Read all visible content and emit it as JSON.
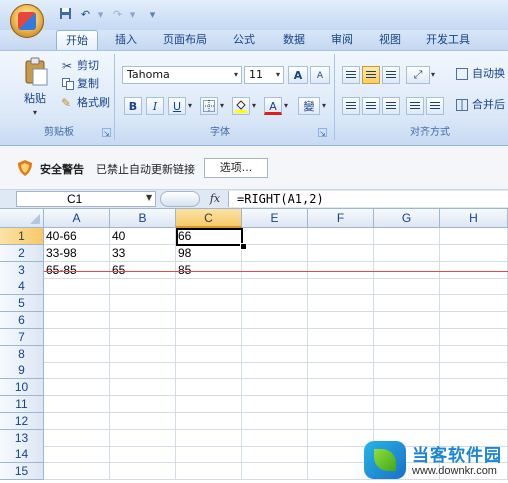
{
  "quick_access": {
    "save_icon": "save-icon",
    "undo_icon": "undo-icon",
    "redo_icon": "redo-icon",
    "customize_icon": "dropdown-icon"
  },
  "tabs": [
    {
      "label": "开始",
      "active": true
    },
    {
      "label": "插入"
    },
    {
      "label": "页面布局"
    },
    {
      "label": "公式"
    },
    {
      "label": "数据"
    },
    {
      "label": "审阅"
    },
    {
      "label": "视图"
    },
    {
      "label": "开发工具"
    }
  ],
  "ribbon": {
    "clipboard": {
      "paste_label": "粘贴",
      "cut_label": "剪切",
      "copy_label": "复制",
      "format_painter_label": "格式刷",
      "group_label": "剪贴板"
    },
    "font": {
      "font_name": "Tahoma",
      "font_size": "11",
      "grow_label": "A",
      "shrink_label": "A",
      "bold": "B",
      "italic": "I",
      "underline": "U",
      "font_color_label": "A",
      "phonetic_label": "變",
      "group_label": "字体"
    },
    "alignment": {
      "wrap_text_label": "自动换",
      "merge_label": "合并后",
      "group_label": "对齐方式"
    }
  },
  "security_bar": {
    "title": "安全警告",
    "message": "已禁止自动更新链接",
    "options_button": "选项..."
  },
  "formula_bar": {
    "name_box": "C1",
    "fx_label": "fx",
    "formula": "=RIGHT(A1,2)"
  },
  "sheet": {
    "columns": [
      "A",
      "B",
      "C",
      "E",
      "F",
      "G",
      "H"
    ],
    "selected_column": "C",
    "rows": [
      "1",
      "2",
      "3",
      "4",
      "5",
      "6",
      "7",
      "8",
      "9",
      "10",
      "11",
      "12",
      "13",
      "14",
      "15"
    ],
    "selected_row": "1",
    "cells": [
      [
        "40-66",
        "40",
        "66"
      ],
      [
        "33-98",
        "33",
        "98"
      ],
      [
        "65-85",
        "65",
        "85"
      ]
    ],
    "active_cell": "C1"
  },
  "watermark": {
    "title": "当客软件园",
    "url": "www.downkr.com"
  }
}
